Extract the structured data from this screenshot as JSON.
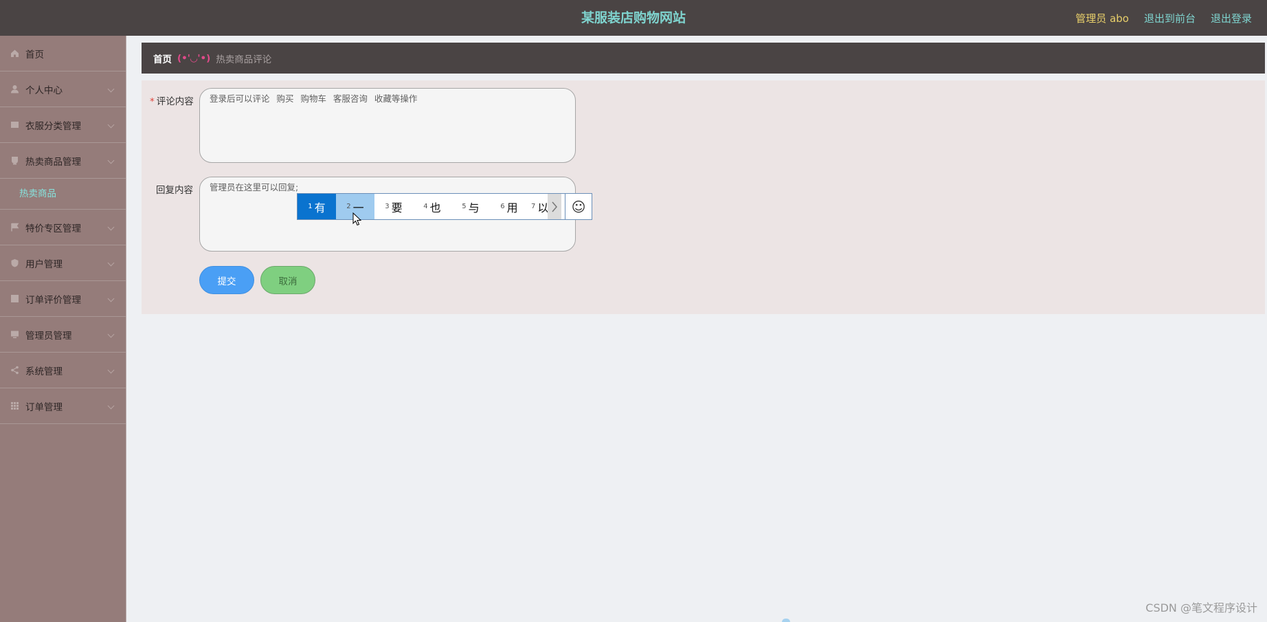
{
  "header": {
    "title": "某服装店购物网站",
    "admin_label": "管理员 abo",
    "links": [
      "退出到前台",
      "退出登录"
    ]
  },
  "sidebar": {
    "items": [
      {
        "label": "首页",
        "icon": "home-icon"
      },
      {
        "label": "个人中心",
        "icon": "user-icon"
      },
      {
        "label": "衣服分类管理",
        "icon": "list-icon"
      },
      {
        "label": "热卖商品管理",
        "icon": "cup-icon"
      },
      {
        "label": "特价专区管理",
        "icon": "flag-icon"
      },
      {
        "label": "用户管理",
        "icon": "shield-icon"
      },
      {
        "label": "订单评价管理",
        "icon": "table-icon"
      },
      {
        "label": "管理员管理",
        "icon": "monitor-icon"
      },
      {
        "label": "系统管理",
        "icon": "share-icon"
      },
      {
        "label": "订单管理",
        "icon": "grid-icon"
      }
    ],
    "open_subitem": "热卖商品"
  },
  "breadcrumb": {
    "home": "首页",
    "face": "(•'◡'•)",
    "current": "热卖商品评论"
  },
  "form": {
    "comment_label": "评论内容",
    "comment_required_mark": "*",
    "comment_value": "登录后可以评论 购买 购物车 客服咨询 收藏等操作",
    "reply_label": "回复内容",
    "reply_value": "管理员在这里可以回复;",
    "submit_label": "提交",
    "cancel_label": "取消"
  },
  "ime": {
    "candidates": [
      {
        "num": "1",
        "char": "有"
      },
      {
        "num": "2",
        "char": "一"
      },
      {
        "num": "3",
        "char": "要"
      },
      {
        "num": "4",
        "char": "也"
      },
      {
        "num": "5",
        "char": "与"
      },
      {
        "num": "6",
        "char": "用"
      },
      {
        "num": "7",
        "char": "以"
      }
    ],
    "emoji_icon": "☺"
  },
  "watermark": "CSDN @笔文程序设计",
  "colors": {
    "topbar": "#4a4444",
    "accent_teal": "#7fd4cf",
    "admin_yellow": "#e8cf6a",
    "sidebar": "#957c7a",
    "submit": "#4a9ff5",
    "cancel": "#7fcf80"
  }
}
